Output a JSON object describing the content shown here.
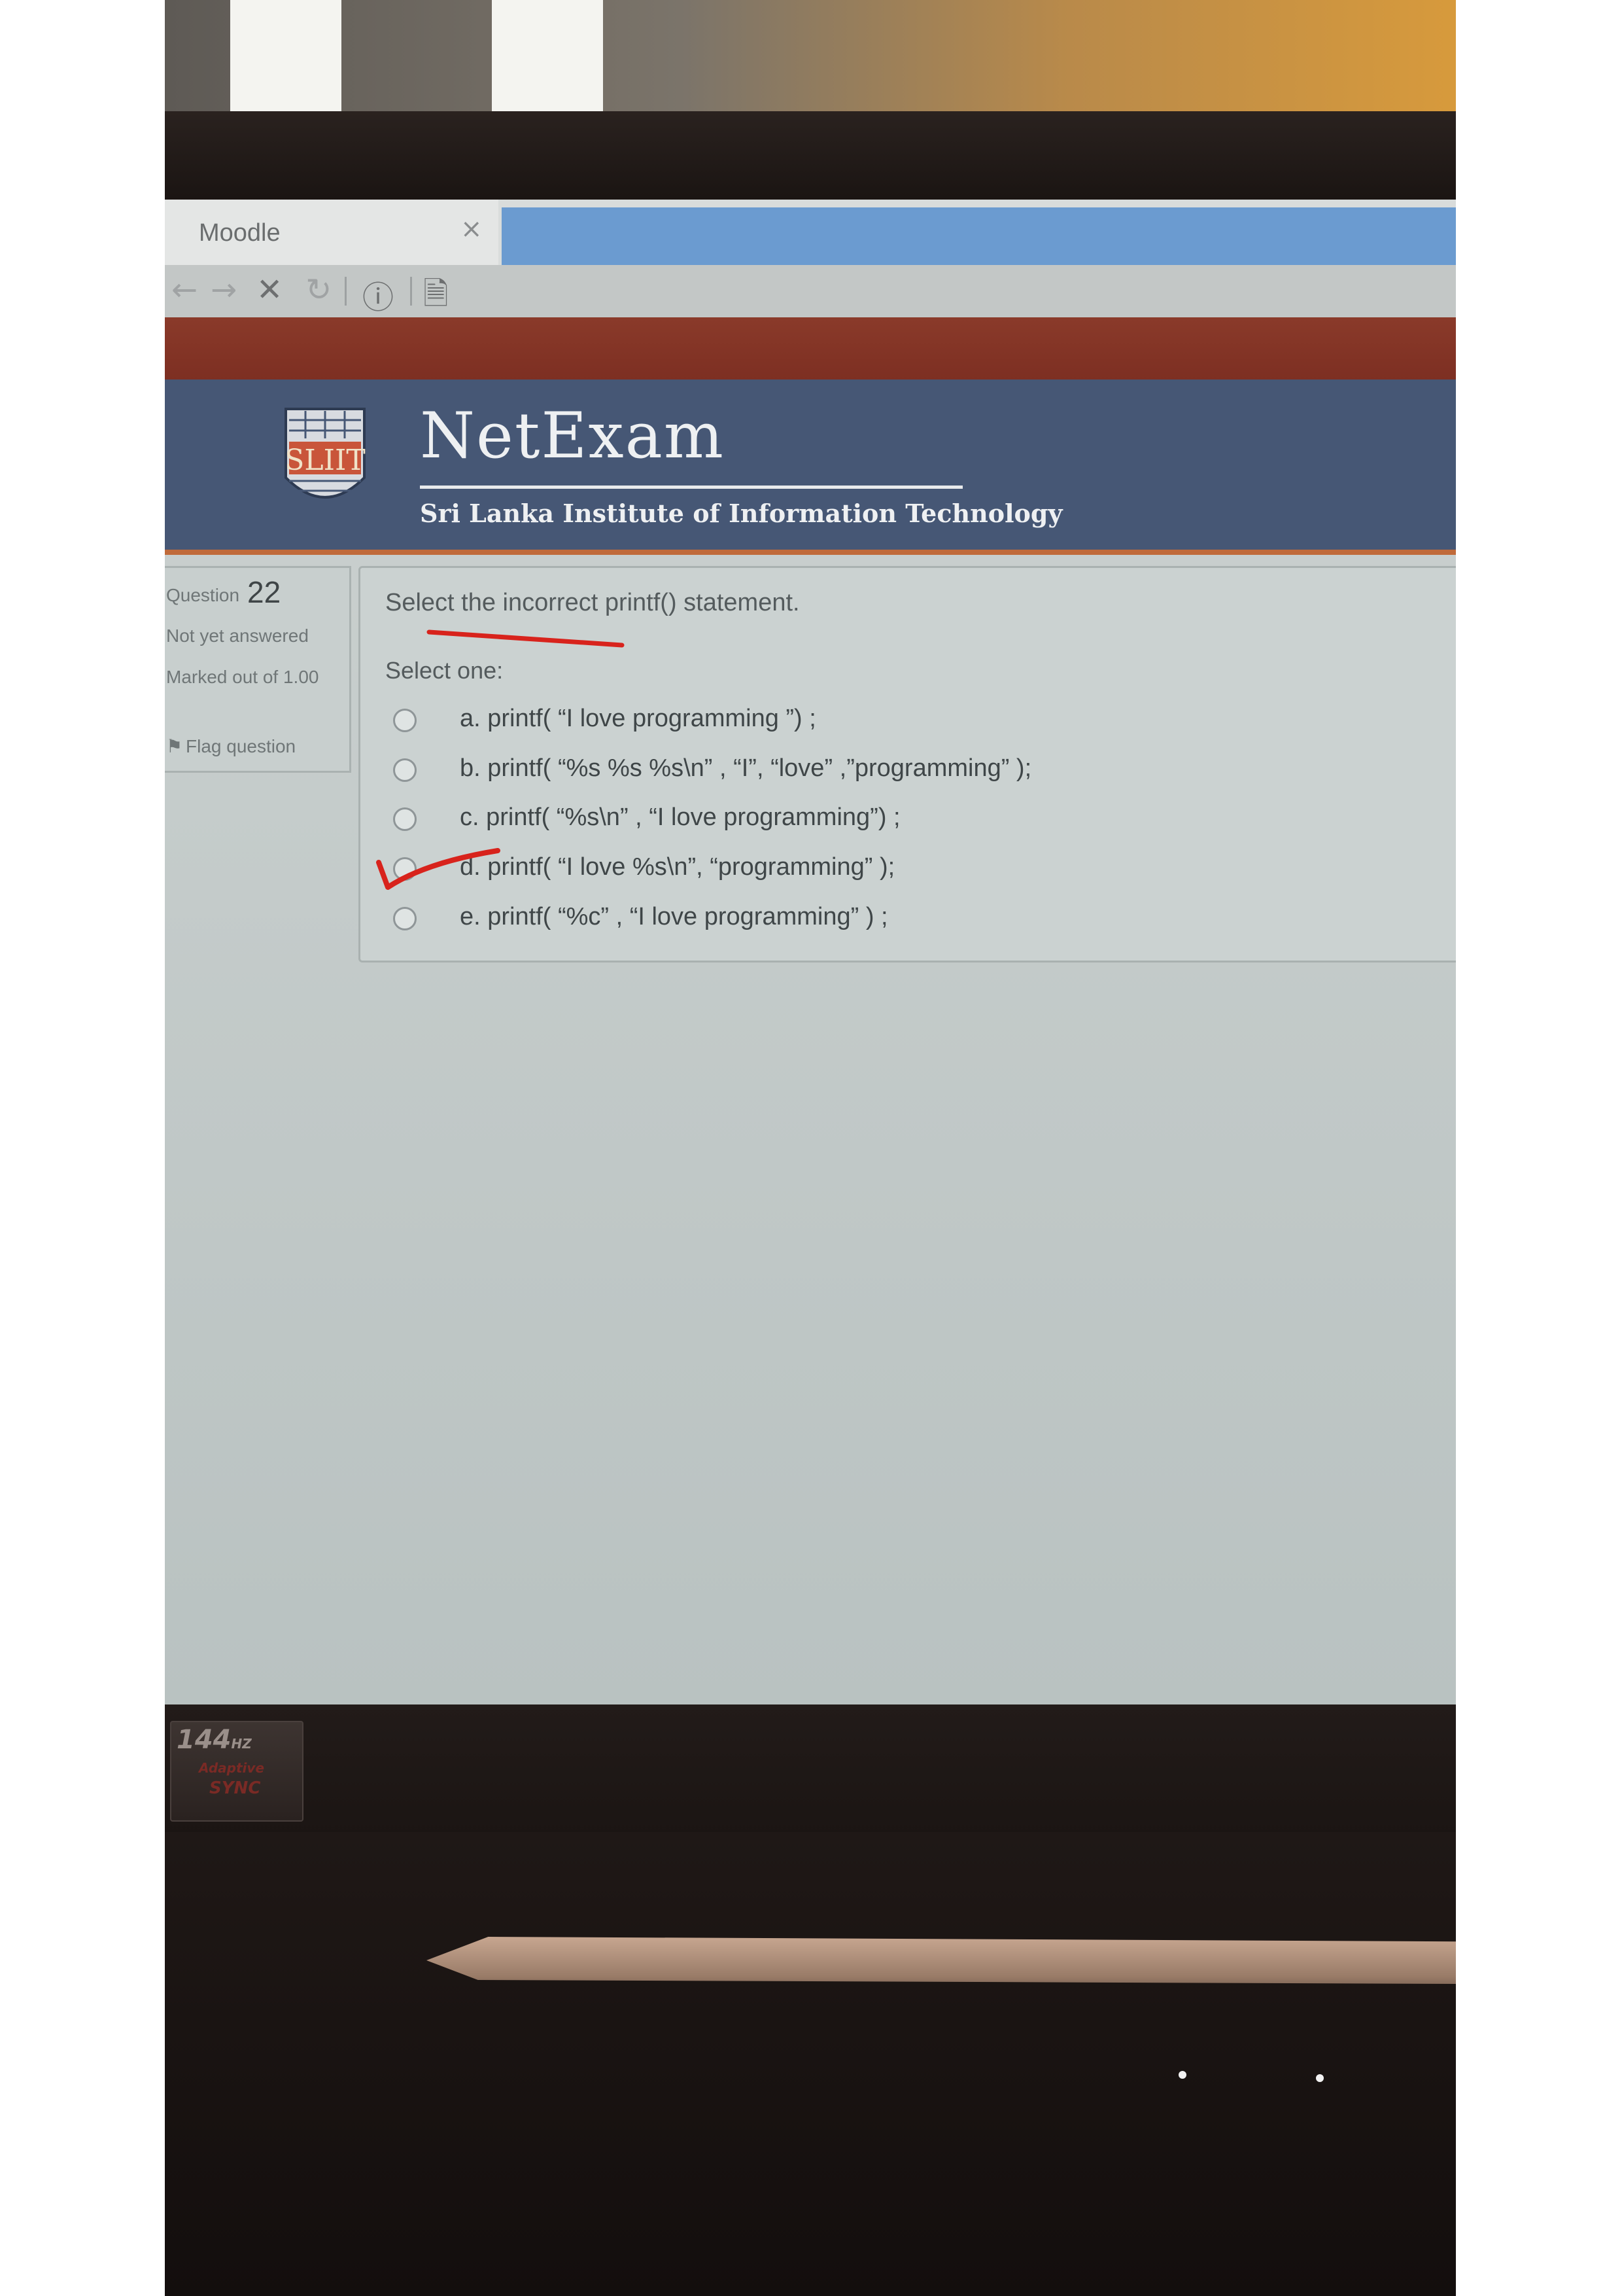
{
  "browser": {
    "tab_title": "Moodle",
    "tab_close": "×",
    "nav": {
      "back": "←",
      "forward": "→",
      "stop": "✕",
      "reload": "↻",
      "info": "ⓘ",
      "page": "🗎"
    }
  },
  "header": {
    "logo_text": "SLIIT",
    "title": "NetExam",
    "subtitle": "Sri Lanka Institute of Information Technology",
    "colors": {
      "header_bg": "#465775",
      "accent": "#c06a3a"
    }
  },
  "question_info": {
    "label": "Question",
    "number": "22",
    "state": "Not yet answered",
    "marked": "Marked out of 1.00",
    "flag_icon": "flag-icon",
    "flag_label": "Flag question"
  },
  "question": {
    "text": "Select the incorrect printf() statement.",
    "select_one": "Select one:",
    "options": [
      {
        "label": "a. printf( “I love programming ”) ;",
        "selected": false
      },
      {
        "label": "b. printf( “%s %s %s\\n” , “I”, “love” ,”programming” );",
        "selected": false
      },
      {
        "label": "c. printf( “%s\\n” , “I love programming”) ;",
        "selected": false
      },
      {
        "label": "d. printf( “I love %s\\n”, “programming” );",
        "selected": false
      },
      {
        "label": "e. printf( “%c” , “I love programming” ) ;",
        "selected": false
      }
    ]
  },
  "monitor": {
    "sticker_rate": "144",
    "sticker_unit": "HZ",
    "sticker_line1": "Adaptive",
    "sticker_line2": "SYNC"
  }
}
